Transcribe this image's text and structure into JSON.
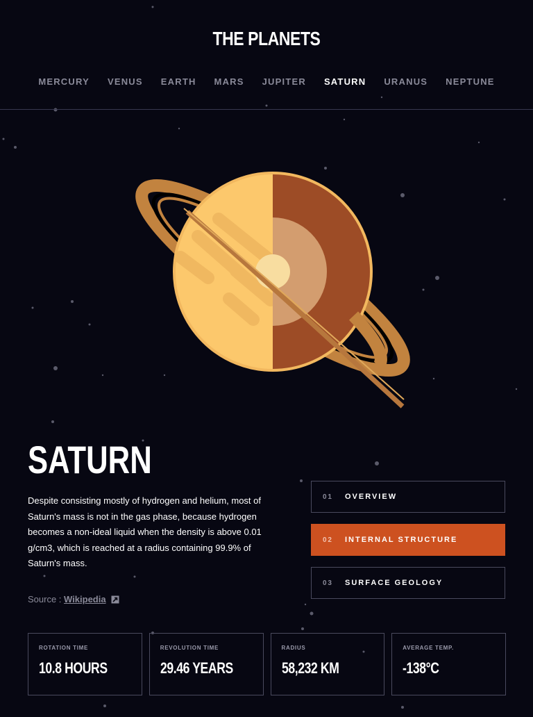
{
  "app": {
    "title": "THE PLANETS"
  },
  "nav": {
    "items": [
      "MERCURY",
      "VENUS",
      "EARTH",
      "MARS",
      "JUPITER",
      "SATURN",
      "URANUS",
      "NEPTUNE"
    ],
    "active": "SATURN"
  },
  "planet": {
    "name": "SATURN",
    "description": "Despite consisting mostly of hydrogen and helium, most of Saturn's mass is not in the gas phase, because hydrogen becomes a non-ideal liquid when the density is above 0.01 g/cm3, which is reached at a radius containing 99.9% of Saturn's mass.",
    "source_prefix": "Source : ",
    "source_link": "Wikipedia",
    "source_icon": "external-link-icon"
  },
  "tabs": [
    {
      "num": "01",
      "label": "OVERVIEW"
    },
    {
      "num": "02",
      "label": "INTERNAL STRUCTURE"
    },
    {
      "num": "03",
      "label": "SURFACE GEOLOGY"
    }
  ],
  "stats": [
    {
      "label": "ROTATION TIME",
      "value": "10.8 HOURS"
    },
    {
      "label": "REVOLUTION TIME",
      "value": "29.46 YEARS"
    },
    {
      "label": "RADIUS",
      "value": "58,232 KM"
    },
    {
      "label": "AVERAGE TEMP.",
      "value": "-138°C"
    }
  ],
  "colors": {
    "accent": "#cd5120",
    "background": "#070712",
    "border": "#4a4a5e"
  }
}
